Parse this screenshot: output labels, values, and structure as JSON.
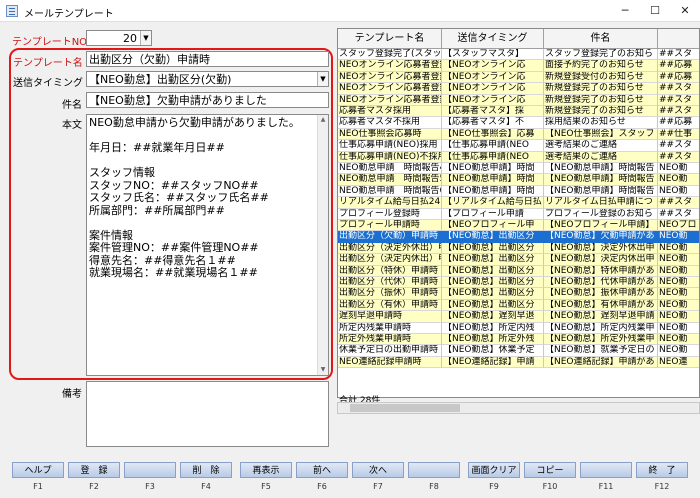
{
  "window": {
    "title": "メールテンプレート",
    "min": "─",
    "max": "☐",
    "close": "✕"
  },
  "form": {
    "template_no_label": "テンプレートNO",
    "template_no_value": "20",
    "template_name_label": "テンプレート名",
    "template_name_value": "出勤区分（欠勤）申請時",
    "timing_label": "送信タイミング",
    "timing_value": "【NEO勤怠】出勤区分(欠勤)",
    "subject_label": "件名",
    "subject_value": "【NEO勤怠】欠勤申請がありました",
    "body_label": "本文",
    "body_lines": [
      "NEO勤怠申請から欠勤申請がありました。",
      "",
      "年月日：##就業年月日##",
      "",
      "スタッフ情報",
      "スタッフNO：##スタッフNO##",
      "スタッフ氏名：##スタッフ氏名##",
      "所属部門：##所属部門##",
      "",
      "案件情報",
      "案件管理NO：##案件管理NO##",
      "得意先名：##得意先名１##",
      "就業現場名：##就業現場名１##"
    ],
    "memo_label": "備考"
  },
  "grid": {
    "headers": [
      "テンプレート名",
      "送信タイミング",
      "件名",
      ""
    ],
    "rows": [
      [
        "スタッフ登録完了(スタッ",
        "【スタッフマスタ】",
        "スタッフ登録完了のお知ら",
        "##スタ"
      ],
      [
        "NEOオンライン応募者登録",
        "【NEOオンライン応",
        "面接予約完了のお知らせ",
        "##応募"
      ],
      [
        "NEOオンライン応募者登録",
        "【NEOオンライン応",
        "新規登録受付のお知らせ",
        "##応募"
      ],
      [
        "NEOオンライン応募者登録",
        "【NEOオンライン応",
        "新規登録完了のお知らせ",
        "##スタ"
      ],
      [
        "NEOオンライン応募者登録",
        "【NEOオンライン応",
        "新規登録完了のお知らせ",
        "##スタ"
      ],
      [
        "応募者マスタ採用",
        "【応募者マスタ】採",
        "新規登録完了のお知らせ",
        "##スタ"
      ],
      [
        "応募者マスタ不採用",
        "【応募者マスタ】不",
        "採用結果のお知らせ",
        "##応募"
      ],
      [
        "NEO仕事照会応募時",
        "【NEO仕事照会】応募",
        "【NEO仕事照会】スタッフ",
        "##仕事"
      ],
      [
        "仕事応募申請(NEO)採用",
        "【仕事応募申請(NEO",
        "選考結果のご連絡",
        "##スタ"
      ],
      [
        "仕事応募申請(NEO)不採用",
        "【仕事応募申請(NEO",
        "選考結果のご連絡",
        "##スタ"
      ],
      [
        "NEO勤怠申請　時間報告4",
        "【NEO勤怠申請】時間",
        "【NEO勤怠申請】時間報告",
        "NEO勤"
      ],
      [
        "NEO勤怠申請　時間報告5",
        "【NEO勤怠申請】時間",
        "【NEO勤怠申請】時間報告",
        "NEO勤"
      ],
      [
        "NEO勤怠申請　時間報告6",
        "【NEO勤怠申請】時間",
        "【NEO勤怠申請】時間報告",
        "NEO勤"
      ],
      [
        "リアルタイム給与日払24",
        "【リアルタイム給与日払",
        "リアルタイム日払申請につ",
        "##スタ"
      ],
      [
        "プロフィール登録時",
        "【プロフィール申請",
        "プロフィール登録のお知ら",
        "##スタ"
      ],
      [
        "プロフィール申請時",
        "【NEOプロフィール申",
        "【NEOプロフィール申請】",
        "NEOプロ"
      ],
      [
        "出勤区分（欠勤）申請時",
        "【NEO勤怠】出勤区分",
        "【NEO勤怠】欠勤申請があ",
        "NEO勤"
      ],
      [
        "出勤区分（決定外休出）申",
        "【NEO勤怠】出勤区分",
        "【NEO勤怠】決定外休出申",
        "NEO勤"
      ],
      [
        "出勤区分（決定内休出）申",
        "【NEO勤怠】出勤区分",
        "【NEO勤怠】決定内休出申",
        "NEO勤"
      ],
      [
        "出勤区分（特休）申請時",
        "【NEO勤怠】出勤区分",
        "【NEO勤怠】特休申請があ",
        "NEO勤"
      ],
      [
        "出勤区分（代休）申請時",
        "【NEO勤怠】出勤区分",
        "【NEO勤怠】代休申請があ",
        "NEO勤"
      ],
      [
        "出勤区分（振休）申請時",
        "【NEO勤怠】出勤区分",
        "【NEO勤怠】振休申請があ",
        "NEO勤"
      ],
      [
        "出勤区分（有休）申請時",
        "【NEO勤怠】出勤区分",
        "【NEO勤怠】有休申請があ",
        "NEO勤"
      ],
      [
        "遅刻早退申請時",
        "【NEO勤怠】遅刻早退",
        "【NEO勤怠】遅刻早退申請",
        "NEO勤"
      ],
      [
        "所定内残業申請時",
        "【NEO勤怠】所定内残",
        "【NEO勤怠】所定内残業申",
        "NEO勤"
      ],
      [
        "所定外残業申請時",
        "【NEO勤怠】所定外残",
        "【NEO勤怠】所定外残業申",
        "NEO勤"
      ],
      [
        "休業予定日の出勤申請時",
        "【NEO勤怠】休業予定",
        "【NEO勤怠】就業予定日の",
        "NEO勤"
      ],
      [
        "NEO連絡記録申請時",
        "【NEO連絡記録】申請",
        "【NEO連絡記録】申請があ",
        "NEO連"
      ]
    ],
    "total": "合計 28件"
  },
  "fkeys": [
    {
      "label": "ヘルプ",
      "key": "F1"
    },
    {
      "label": "登　録",
      "key": "F2"
    },
    {
      "label": "",
      "key": "F3"
    },
    {
      "label": "削　除",
      "key": "F4"
    },
    {
      "label": "再表示",
      "key": "F5"
    },
    {
      "label": "前へ",
      "key": "F6"
    },
    {
      "label": "次へ",
      "key": "F7"
    },
    {
      "label": "",
      "key": "F8"
    },
    {
      "label": "画面クリア",
      "key": "F9"
    },
    {
      "label": "コピー",
      "key": "F10"
    },
    {
      "label": "",
      "key": "F11"
    },
    {
      "label": "終　了",
      "key": "F12"
    }
  ]
}
